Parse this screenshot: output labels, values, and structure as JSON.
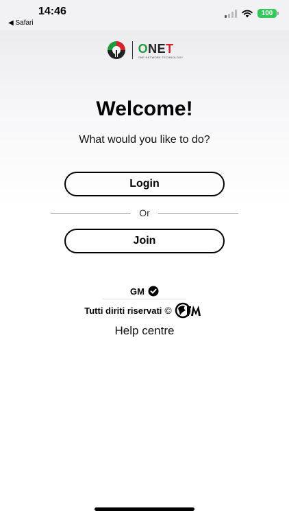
{
  "status_bar": {
    "time": "14:46",
    "back_app": "◀ Safari",
    "battery": "100",
    "signal_icon": "cellular-signal-icon",
    "wifi_icon": "wifi-icon"
  },
  "brand": {
    "logo_icon": "onet-logo-icon",
    "name_o": "O",
    "name_ne": "NE",
    "name_t": "T",
    "tagline": "ONE NETWORK TECHNOLOGY",
    "colors": {
      "green": "#1f9a3c",
      "red": "#d2232a"
    }
  },
  "main": {
    "title": "Welcome!",
    "question": "What would you like to do?",
    "login_label": "Login",
    "or_label": "Or",
    "join_label": "Join"
  },
  "footer": {
    "gm_label": "GM",
    "verified_icon": "verified-check-icon",
    "rights_text": "Tutti diriti riservati",
    "copyright_symbol": "©",
    "gm_logo_icon": "gm-logo-icon",
    "help_label": "Help centre"
  }
}
